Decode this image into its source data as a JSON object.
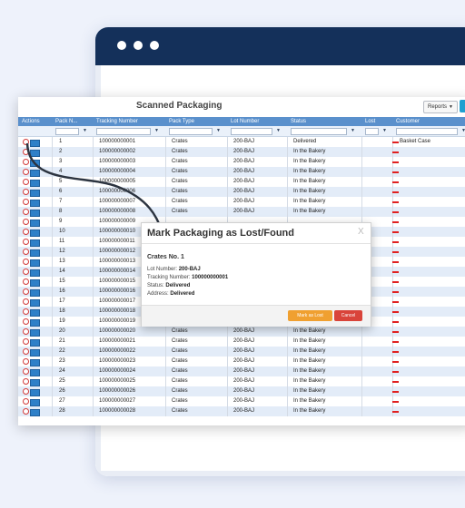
{
  "app": {
    "title": "Scanned Packaging",
    "reports_label": "Reports"
  },
  "columns": [
    "Actions",
    "Pack N...",
    "Tracking Number",
    "Pack Type",
    "Lot Number",
    "Status",
    "Lost",
    "Customer"
  ],
  "rows": [
    {
      "pack": "1",
      "tracking": "100000000001",
      "type": "Crates",
      "lot": "200-BAJ",
      "status": "Delivered",
      "customer": "Basket Case"
    },
    {
      "pack": "2",
      "tracking": "100000000002",
      "type": "Crates",
      "lot": "200-BAJ",
      "status": "In the Bakery",
      "customer": ""
    },
    {
      "pack": "3",
      "tracking": "100000000003",
      "type": "Crates",
      "lot": "200-BAJ",
      "status": "In the Bakery",
      "customer": ""
    },
    {
      "pack": "4",
      "tracking": "100000000004",
      "type": "Crates",
      "lot": "200-BAJ",
      "status": "In the Bakery",
      "customer": ""
    },
    {
      "pack": "5",
      "tracking": "100000000005",
      "type": "Crates",
      "lot": "200-BAJ",
      "status": "In the Bakery",
      "customer": ""
    },
    {
      "pack": "6",
      "tracking": "100000000006",
      "type": "Crates",
      "lot": "200-BAJ",
      "status": "In the Bakery",
      "customer": ""
    },
    {
      "pack": "7",
      "tracking": "100000000007",
      "type": "Crates",
      "lot": "200-BAJ",
      "status": "In the Bakery",
      "customer": ""
    },
    {
      "pack": "8",
      "tracking": "100000000008",
      "type": "Crates",
      "lot": "200-BAJ",
      "status": "In the Bakery",
      "customer": ""
    },
    {
      "pack": "9",
      "tracking": "100000000009",
      "type": "",
      "lot": "",
      "status": "",
      "customer": ""
    },
    {
      "pack": "10",
      "tracking": "100000000010",
      "type": "",
      "lot": "",
      "status": "",
      "customer": ""
    },
    {
      "pack": "11",
      "tracking": "100000000011",
      "type": "",
      "lot": "",
      "status": "",
      "customer": ""
    },
    {
      "pack": "12",
      "tracking": "100000000012",
      "type": "",
      "lot": "",
      "status": "",
      "customer": ""
    },
    {
      "pack": "13",
      "tracking": "100000000013",
      "type": "",
      "lot": "",
      "status": "",
      "customer": ""
    },
    {
      "pack": "14",
      "tracking": "100000000014",
      "type": "",
      "lot": "",
      "status": "",
      "customer": ""
    },
    {
      "pack": "15",
      "tracking": "100000000015",
      "type": "",
      "lot": "",
      "status": "",
      "customer": ""
    },
    {
      "pack": "16",
      "tracking": "100000000016",
      "type": "",
      "lot": "",
      "status": "",
      "customer": ""
    },
    {
      "pack": "17",
      "tracking": "100000000017",
      "type": "",
      "lot": "",
      "status": "",
      "customer": ""
    },
    {
      "pack": "18",
      "tracking": "100000000018",
      "type": "",
      "lot": "",
      "status": "",
      "customer": ""
    },
    {
      "pack": "19",
      "tracking": "100000000019",
      "type": "",
      "lot": "",
      "status": "",
      "customer": ""
    },
    {
      "pack": "20",
      "tracking": "100000000020",
      "type": "Crates",
      "lot": "200-BAJ",
      "status": "In the Bakery",
      "customer": ""
    },
    {
      "pack": "21",
      "tracking": "100000000021",
      "type": "Crates",
      "lot": "200-BAJ",
      "status": "In the Bakery",
      "customer": ""
    },
    {
      "pack": "22",
      "tracking": "100000000022",
      "type": "Crates",
      "lot": "200-BAJ",
      "status": "In the Bakery",
      "customer": ""
    },
    {
      "pack": "23",
      "tracking": "100000000023",
      "type": "Crates",
      "lot": "200-BAJ",
      "status": "In the Bakery",
      "customer": ""
    },
    {
      "pack": "24",
      "tracking": "100000000024",
      "type": "Crates",
      "lot": "200-BAJ",
      "status": "In the Bakery",
      "customer": ""
    },
    {
      "pack": "25",
      "tracking": "100000000025",
      "type": "Crates",
      "lot": "200-BAJ",
      "status": "In the Bakery",
      "customer": ""
    },
    {
      "pack": "26",
      "tracking": "100000000026",
      "type": "Crates",
      "lot": "200-BAJ",
      "status": "In the Bakery",
      "customer": ""
    },
    {
      "pack": "27",
      "tracking": "100000000027",
      "type": "Crates",
      "lot": "200-BAJ",
      "status": "In the Bakery",
      "customer": ""
    },
    {
      "pack": "28",
      "tracking": "100000000028",
      "type": "Crates",
      "lot": "200-BAJ",
      "status": "In the Bakery",
      "customer": ""
    }
  ],
  "modal": {
    "title": "Mark Packaging as Lost/Found",
    "close": "X",
    "subtitle": "Crates No. 1",
    "fields": [
      {
        "label": "Lot Number:",
        "value": "200-BAJ"
      },
      {
        "label": "Tracking Number:",
        "value": "100000000001"
      },
      {
        "label": "Status:",
        "value": "Delivered"
      },
      {
        "label": "Address:",
        "value": "Delivered"
      }
    ],
    "mark_label": "Mark as Lost",
    "cancel_label": "Cancel"
  },
  "colors": {
    "header": "#5a90cc",
    "navy": "#14305a",
    "lost_mark": "#e02020",
    "mark_button": "#f0a030",
    "cancel_button": "#d9443a"
  }
}
